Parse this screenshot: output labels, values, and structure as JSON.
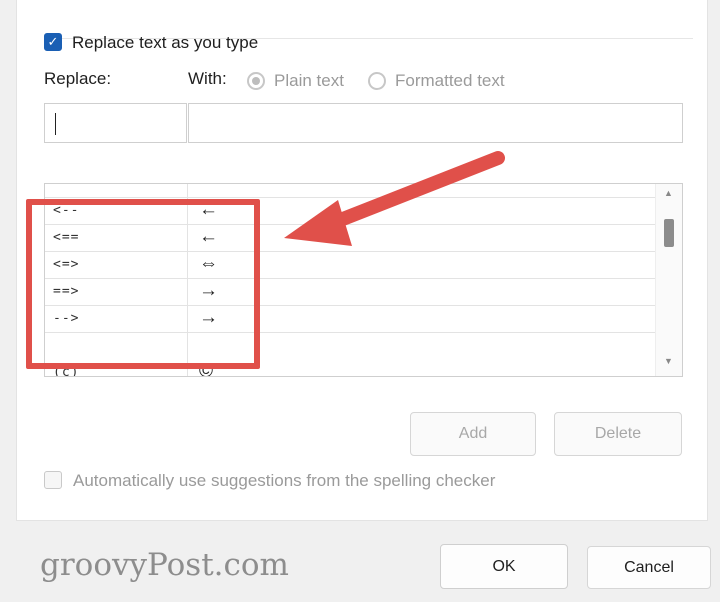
{
  "replace_as_you_type": {
    "label": "Replace text as you type",
    "checked": true
  },
  "replace_label": "Replace:",
  "with_label": "With:",
  "format_options": [
    {
      "label": "Plain text",
      "selected": true
    },
    {
      "label": "Formatted text",
      "selected": false
    }
  ],
  "replace_field": {
    "value": ""
  },
  "with_field": {
    "value": ""
  },
  "entries": [
    {
      "replace": "--",
      "with": "—"
    },
    {
      "replace": "<--",
      "with": "←"
    },
    {
      "replace": "<==",
      "with": "←"
    },
    {
      "replace": "<=>",
      "with": "⇔"
    },
    {
      "replace": "==>",
      "with": "→"
    },
    {
      "replace": "-->",
      "with": "→"
    },
    {
      "replace": "(c)",
      "with": "©"
    }
  ],
  "buttons": {
    "add": "Add",
    "delete": "Delete",
    "ok": "OK",
    "cancel": "Cancel"
  },
  "spelling_suggestions": {
    "label": "Automatically use suggestions from the spelling checker",
    "checked": false
  },
  "watermark": "groovyPost.com",
  "colors": {
    "accent": "#1a5fb4",
    "annotation": "#e0504a"
  },
  "icons": {
    "check": "checkmark-icon",
    "scroll_up": "chevron-up-icon",
    "scroll_down": "chevron-down-icon"
  }
}
